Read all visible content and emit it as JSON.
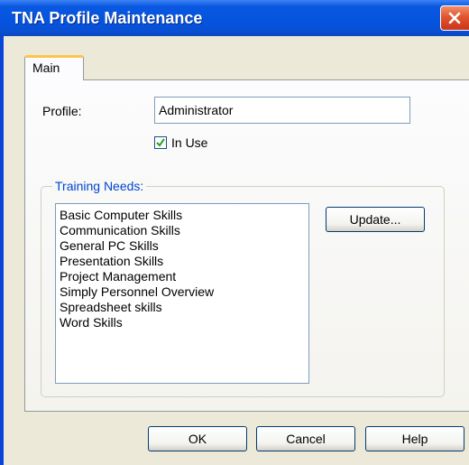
{
  "window": {
    "title": "TNA Profile Maintenance"
  },
  "tabs": [
    {
      "label": "Main"
    }
  ],
  "form": {
    "profile_label": "Profile:",
    "profile_value": "Administrator",
    "in_use_label": "In Use",
    "in_use_checked": true
  },
  "training_needs": {
    "title": "Training Needs:",
    "items": [
      "Basic Computer Skills",
      "Communication Skills",
      "General PC Skills",
      "Presentation Skills",
      "Project Management",
      "Simply Personnel Overview",
      "Spreadsheet skills",
      "Word Skills"
    ],
    "update_label": "Update..."
  },
  "buttons": {
    "ok": "OK",
    "cancel": "Cancel",
    "help": "Help"
  }
}
